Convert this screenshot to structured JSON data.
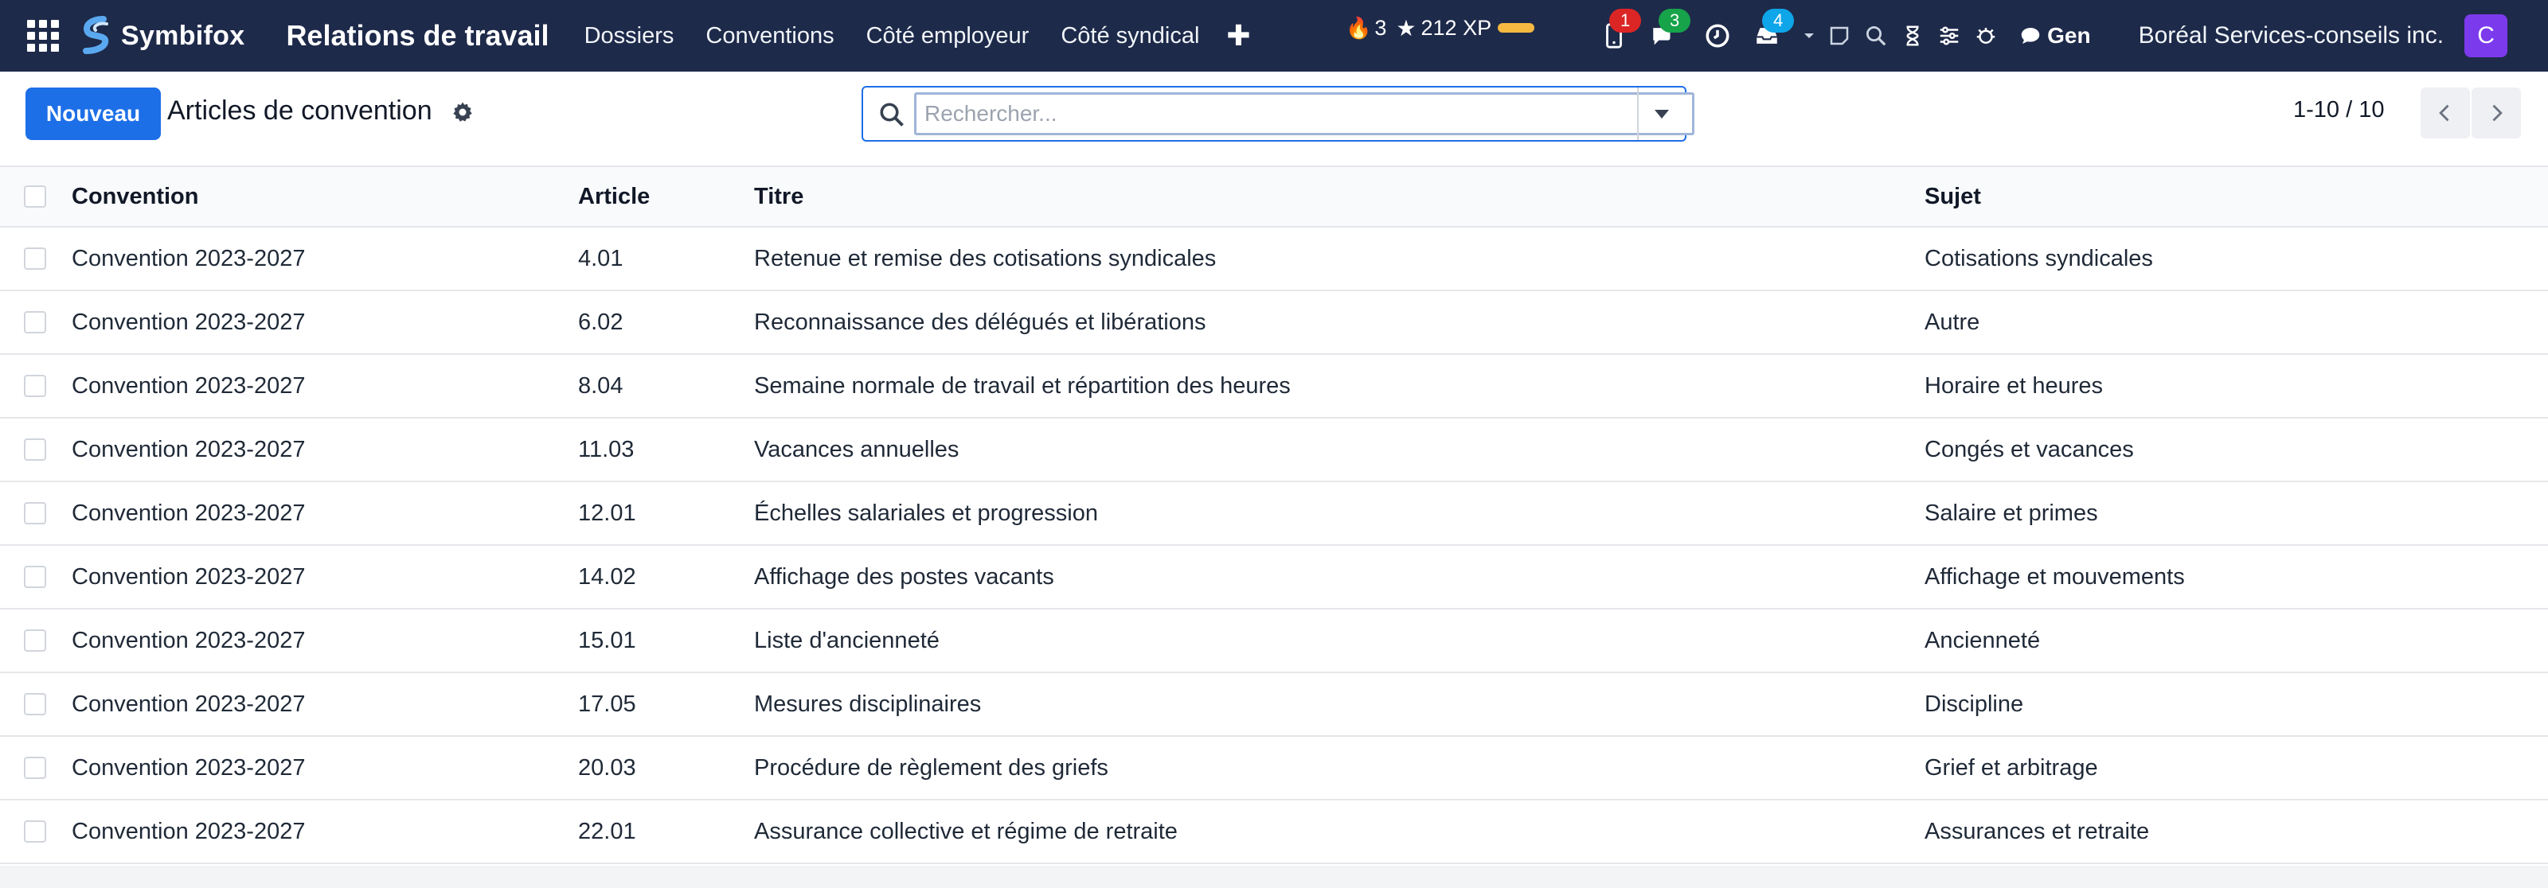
{
  "topbar": {
    "brand": "Symbifox",
    "app_title": "Relations de travail",
    "nav": [
      "Dossiers",
      "Conventions",
      "Côté employeur",
      "Côté syndical"
    ],
    "streak": "3",
    "xp": "212 XP",
    "badges": {
      "phone": "1",
      "chat": "3",
      "inbox": "4"
    },
    "gen_label": "Gen",
    "company": "Boréal Services-conseils inc.",
    "avatar_initial": "C"
  },
  "controls": {
    "new_label": "Nouveau",
    "title": "Articles de convention",
    "search_placeholder": "Rechercher...",
    "pager": "1-10 / 10"
  },
  "table": {
    "headers": {
      "convention": "Convention",
      "article": "Article",
      "titre": "Titre",
      "sujet": "Sujet"
    },
    "rows": [
      {
        "convention": "Convention 2023-2027",
        "article": "4.01",
        "titre": "Retenue et remise des cotisations syndicales",
        "sujet": "Cotisations syndicales"
      },
      {
        "convention": "Convention 2023-2027",
        "article": "6.02",
        "titre": "Reconnaissance des délégués et libérations",
        "sujet": "Autre"
      },
      {
        "convention": "Convention 2023-2027",
        "article": "8.04",
        "titre": "Semaine normale de travail et répartition des heures",
        "sujet": "Horaire et heures"
      },
      {
        "convention": "Convention 2023-2027",
        "article": "11.03",
        "titre": "Vacances annuelles",
        "sujet": "Congés et vacances"
      },
      {
        "convention": "Convention 2023-2027",
        "article": "12.01",
        "titre": "Échelles salariales et progression",
        "sujet": "Salaire et primes"
      },
      {
        "convention": "Convention 2023-2027",
        "article": "14.02",
        "titre": "Affichage des postes vacants",
        "sujet": "Affichage et mouvements"
      },
      {
        "convention": "Convention 2023-2027",
        "article": "15.01",
        "titre": "Liste d'ancienneté",
        "sujet": "Ancienneté"
      },
      {
        "convention": "Convention 2023-2027",
        "article": "17.05",
        "titre": "Mesures disciplinaires",
        "sujet": "Discipline"
      },
      {
        "convention": "Convention 2023-2027",
        "article": "20.03",
        "titre": "Procédure de règlement des griefs",
        "sujet": "Grief et arbitrage"
      },
      {
        "convention": "Convention 2023-2027",
        "article": "22.01",
        "titre": "Assurance collective et régime de retraite",
        "sujet": "Assurances et retraite"
      }
    ]
  },
  "colors": {
    "topbar": "#1e2a4a",
    "primary": "#1d6fe8",
    "avatar": "#7c3aed"
  }
}
